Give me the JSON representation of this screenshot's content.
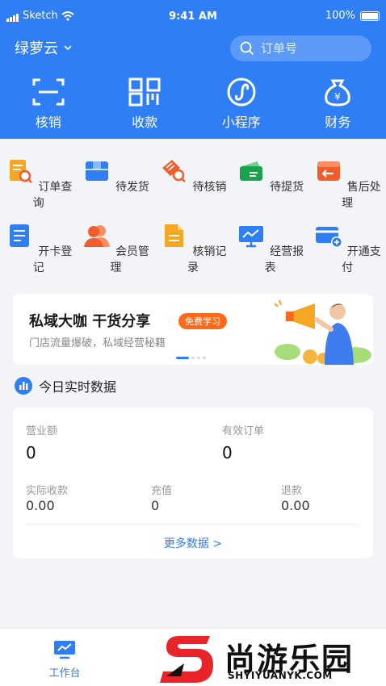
{
  "status_bar": {
    "carrier": "Sketch",
    "time": "9:41 AM",
    "battery": "100%"
  },
  "header": {
    "store_name": "绿萝云",
    "search_placeholder": "订单号",
    "actions": [
      {
        "label": "核销",
        "icon": "scan-icon"
      },
      {
        "label": "收款",
        "icon": "qr-code-icon"
      },
      {
        "label": "小程序",
        "icon": "mini-program-icon"
      },
      {
        "label": "财务",
        "icon": "money-bag-icon"
      }
    ]
  },
  "grid": [
    {
      "label": "订单查询",
      "icon": "order-search-icon",
      "color": "#f5a623"
    },
    {
      "label": "待发货",
      "icon": "shipping-box-icon",
      "color": "#2f7ef5"
    },
    {
      "label": "待核销",
      "icon": "ticket-search-icon",
      "color": "#f25c2a"
    },
    {
      "label": "待提货",
      "icon": "pickup-wallet-icon",
      "color": "#1aa34a"
    },
    {
      "label": "售后处理",
      "icon": "return-icon",
      "color": "#f25c2a"
    },
    {
      "label": "开卡登记",
      "icon": "card-register-icon",
      "color": "#2f7ef5"
    },
    {
      "label": "会员管理",
      "icon": "members-icon",
      "color": "#f25c2a"
    },
    {
      "label": "核销记录",
      "icon": "records-doc-icon",
      "color": "#f5a623"
    },
    {
      "label": "经营报表",
      "icon": "report-chart-icon",
      "color": "#2f7ef5"
    },
    {
      "label": "开通支付",
      "icon": "payment-card-icon",
      "color": "#2f7ef5"
    }
  ],
  "banner": {
    "title": "私域大咖 干货分享",
    "tag": "免费学习",
    "subtitle": "门店流量爆破，私域经营秘籍"
  },
  "realtime": {
    "title": "今日实时数据",
    "revenue_label": "营业额",
    "revenue_value": "0",
    "orders_label": "有效订单",
    "orders_value": "0",
    "received_label": "实际收款",
    "received_value": "0.00",
    "recharge_label": "充值",
    "recharge_value": "0",
    "refund_label": "退款",
    "refund_value": "0.00",
    "more_label": "更多数据 >"
  },
  "tabbar": {
    "workbench_label": "工作台"
  },
  "watermark": {
    "name": "尚游乐园",
    "url": "SHYIYUANYK.COM"
  },
  "colors": {
    "primary": "#2f7ef5",
    "accent_orange": "#ff6a1a"
  }
}
